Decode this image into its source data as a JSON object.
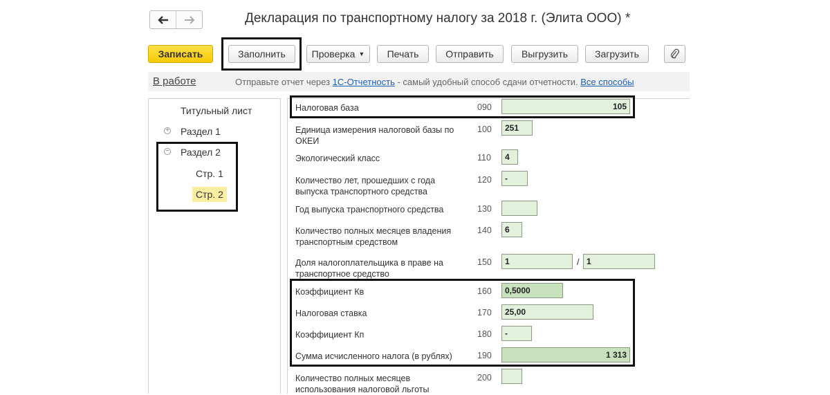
{
  "window": {
    "title": "Декларация по транспортному налогу за 2018 г. (Элита ООО) *",
    "back_icon": "arrow-left-icon",
    "forward_icon": "arrow-right-icon"
  },
  "toolbar": {
    "save": "Записать",
    "fill": "Заполнить",
    "check": "Проверка",
    "print": "Печать",
    "send": "Отправить",
    "export": "Выгрузить",
    "import": "Загрузить",
    "attach_icon": "paperclip-icon"
  },
  "status": {
    "state": "В работе",
    "message_prefix": "Отправьте отчет через ",
    "message_link": "1С-Отчетность",
    "message_suffix": " - самый удобный способ сдачи отчетности. ",
    "all_ways": "Все способы"
  },
  "tree": {
    "title_sheet": "Титульный лист",
    "section1": "Раздел 1",
    "section2": "Раздел 2",
    "page1": "Стр. 1",
    "page2": "Стр. 2"
  },
  "form": {
    "rows": [
      {
        "label": "Налоговая база",
        "code": "090",
        "value": "105"
      },
      {
        "label": "Единица измерения налоговой базы по ОКЕИ",
        "code": "100",
        "value": "251"
      },
      {
        "label": "Экологический класс",
        "code": "110",
        "value": "4"
      },
      {
        "label": "Количество лет, прошедших с года выпуска транспортного средства",
        "code": "120",
        "value": "-"
      },
      {
        "label": "Год выпуска транспортного средства",
        "code": "130",
        "value": ""
      },
      {
        "label": "Количество полных месяцев владения транспортным средством",
        "code": "140",
        "value": "6"
      },
      {
        "label": "Доля налогоплательщика в праве на транспортное средство",
        "code": "150",
        "value": "1",
        "value2": "1"
      },
      {
        "label": "Коэффициент Кв",
        "code": "160",
        "value": "0,5000"
      },
      {
        "label": "Налоговая ставка",
        "code": "170",
        "value": "25,00"
      },
      {
        "label": "Коэффициент Кп",
        "code": "180",
        "value": "-"
      },
      {
        "label": "Сумма исчисленного налога (в рублях)",
        "code": "190",
        "value": "1 313"
      },
      {
        "label": "Количество полных месяцев использования налоговой льготы",
        "code": "200",
        "value": ""
      }
    ],
    "share_separator": "/"
  }
}
